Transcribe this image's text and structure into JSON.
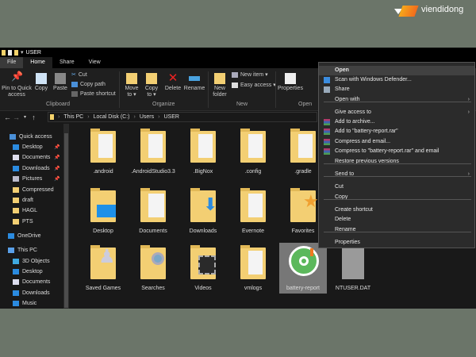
{
  "watermark": "viendidong",
  "title": "USER",
  "ribbon_tabs": [
    "File",
    "Home",
    "Share",
    "View"
  ],
  "ribbon": {
    "pin": "Pin to Quick access",
    "copy": "Copy",
    "paste": "Paste",
    "cut": "Cut",
    "copy_path": "Copy path",
    "paste_shortcut": "Paste shortcut",
    "move_to": "Move to ▾",
    "copy_to": "Copy to ▾",
    "delete": "Delete",
    "rename": "Rename",
    "new_folder": "New folder",
    "new_item": "New item ▾",
    "easy_access": "Easy access ▾",
    "properties": "Properties",
    "groups": [
      "Clipboard",
      "Organize",
      "New",
      "Open"
    ]
  },
  "breadcrumb": [
    "This PC",
    "Local Disk (C:)",
    "Users",
    "USER"
  ],
  "sidebar": [
    {
      "label": "Quick access",
      "pinned": false
    },
    {
      "label": "Desktop",
      "pinned": true
    },
    {
      "label": "Documents",
      "pinned": true
    },
    {
      "label": "Downloads",
      "pinned": true
    },
    {
      "label": "Pictures",
      "pinned": true
    },
    {
      "label": "Compressed",
      "pinned": false
    },
    {
      "label": "draft",
      "pinned": false
    },
    {
      "label": "HAGL",
      "pinned": false
    },
    {
      "label": "PTS",
      "pinned": false
    },
    {
      "label": "OneDrive",
      "pinned": false
    },
    {
      "label": "This PC",
      "pinned": false
    },
    {
      "label": "3D Objects",
      "pinned": false
    },
    {
      "label": "Desktop",
      "pinned": false
    },
    {
      "label": "Documents",
      "pinned": false
    },
    {
      "label": "Downloads",
      "pinned": false
    },
    {
      "label": "Music",
      "pinned": false
    }
  ],
  "items": [
    ".android",
    ".AndroidStudio3.3",
    ".BigNox",
    ".config",
    ".gradle",
    "Desktop",
    "Documents",
    "Downloads",
    "Evernote",
    "Favorites",
    "Saved Games",
    "Searches",
    "Videos",
    "vmlogs",
    "battery-report",
    "NTUSER.DAT"
  ],
  "context_menu": [
    "Open",
    "Scan with Windows Defender...",
    "Share",
    "Open with",
    "Give access to",
    "Add to archive...",
    "Add to \"battery-report.rar\"",
    "Compress and email...",
    "Compress to \"battery-report.rar\" and email",
    "Restore previous versions",
    "Send to",
    "Cut",
    "Copy",
    "Create shortcut",
    "Delete",
    "Rename",
    "Properties"
  ]
}
